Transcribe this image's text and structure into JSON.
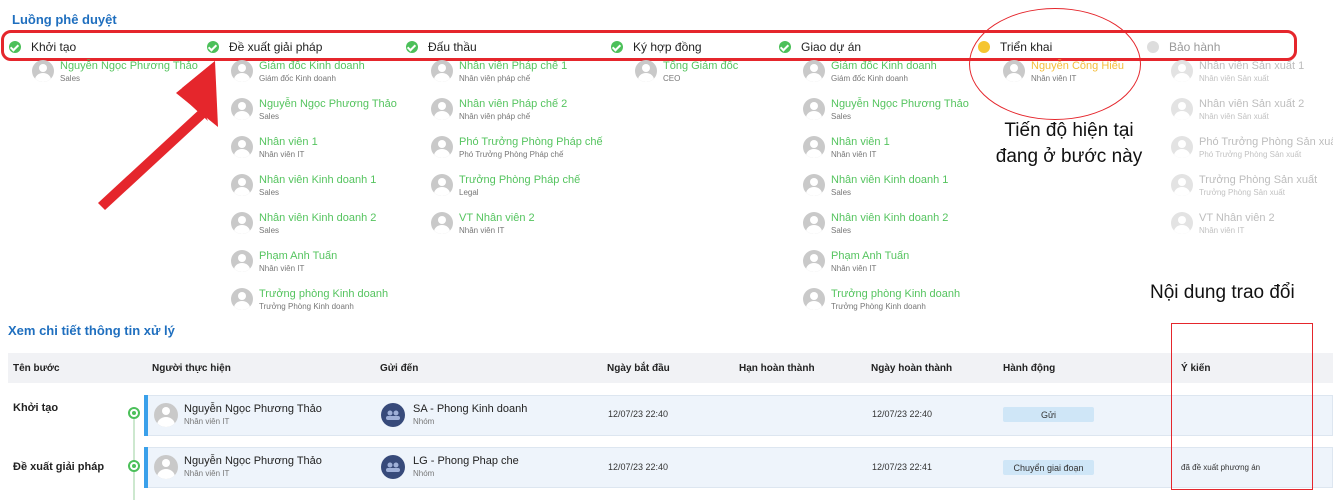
{
  "section_flow_title": "Luồng phê duyệt",
  "section_detail_title": "Xem chi tiết thông tin xử lý",
  "steps": [
    {
      "label": "Khởi tạo",
      "status": "done"
    },
    {
      "label": "Đề xuất giải pháp",
      "status": "done"
    },
    {
      "label": "Đấu thầu",
      "status": "done"
    },
    {
      "label": "Ký hợp đồng",
      "status": "done"
    },
    {
      "label": "Giao dự án",
      "status": "done"
    },
    {
      "label": "Triển khai",
      "status": "current"
    },
    {
      "label": "Bảo hành",
      "status": "pending"
    }
  ],
  "approvers": {
    "khoi_tao": [
      {
        "name": "Nguyễn Ngọc Phương Thảo",
        "role": "Sales"
      }
    ],
    "de_xuat": [
      {
        "name": "Giám đốc Kinh doanh",
        "role": "Giám đốc Kinh doanh"
      },
      {
        "name": "Nguyễn Ngọc Phương Thảo",
        "role": "Sales"
      },
      {
        "name": "Nhân viên 1",
        "role": "Nhân viên IT"
      },
      {
        "name": "Nhân viên Kinh doanh 1",
        "role": "Sales"
      },
      {
        "name": "Nhân viên Kinh doanh 2",
        "role": "Sales"
      },
      {
        "name": "Phạm Anh Tuấn",
        "role": "Nhân viên IT"
      },
      {
        "name": "Trưởng phòng Kinh doanh",
        "role": "Trưởng Phòng Kinh doanh"
      }
    ],
    "dau_thau": [
      {
        "name": "Nhân viên Pháp chế 1",
        "role": "Nhân viên pháp chế"
      },
      {
        "name": "Nhân viên Pháp chế 2",
        "role": "Nhân viên pháp chế"
      },
      {
        "name": "Phó Trưởng Phòng Pháp chế",
        "role": "Phó Trưởng Phòng Pháp chế"
      },
      {
        "name": "Trưởng Phòng Pháp chế",
        "role": "Legal"
      },
      {
        "name": "VT Nhân viên 2",
        "role": "Nhân viên IT"
      }
    ],
    "ky_hop_dong": [
      {
        "name": "Tổng Giám đốc",
        "role": "CEO"
      }
    ],
    "giao_du_an": [
      {
        "name": "Giám đốc Kinh doanh",
        "role": "Giám đốc Kinh doanh"
      },
      {
        "name": "Nguyễn Ngọc Phương Thảo",
        "role": "Sales"
      },
      {
        "name": "Nhân viên 1",
        "role": "Nhân viên IT"
      },
      {
        "name": "Nhân viên Kinh doanh 1",
        "role": "Sales"
      },
      {
        "name": "Nhân viên Kinh doanh 2",
        "role": "Sales"
      },
      {
        "name": "Phạm Anh Tuấn",
        "role": "Nhân viên IT"
      },
      {
        "name": "Trưởng phòng Kinh doanh",
        "role": "Trưởng Phòng Kinh doanh"
      }
    ],
    "trien_khai": [
      {
        "name": "Nguyễn Công Hiếu",
        "role": "Nhân viên IT"
      }
    ],
    "bao_hanh": [
      {
        "name": "Nhân viên Sản xuất 1",
        "role": "Nhân viên Sản xuất"
      },
      {
        "name": "Nhân viên Sản xuất 2",
        "role": "Nhân viên Sản xuất"
      },
      {
        "name": "Phó Trưởng Phòng Sản xuất",
        "role": "Phó Trưởng Phòng Sản xuất"
      },
      {
        "name": "Trưởng Phòng Sản xuất",
        "role": "Trưởng Phòng Sản xuất"
      },
      {
        "name": "VT Nhân viên 2",
        "role": "Nhân viên IT"
      }
    ]
  },
  "annotations": {
    "current_progress": "Tiến độ hiện tại đang ở bước này",
    "exchange_content": "Nội dung trao đổi"
  },
  "table": {
    "headers": [
      "Tên bước",
      "Người thực hiện",
      "Gửi đến",
      "Ngày bắt đầu",
      "Hạn hoàn thành",
      "Ngày hoàn thành",
      "Hành động",
      "Ý kiến"
    ],
    "rows": [
      {
        "step": "Khởi tạo",
        "performer": "Nguyễn Ngọc Phương Thảo",
        "performer_role": "Nhân viên IT",
        "sent_to": "SA - Phong Kinh doanh",
        "sent_to_type": "Nhóm",
        "start": "12/07/23 22:40",
        "deadline": "",
        "completed": "12/07/23 22:40",
        "action": "Gửi",
        "opinion": ""
      },
      {
        "step": "Đề xuất giải pháp",
        "performer": "Nguyễn Ngọc Phương Thảo",
        "performer_role": "Nhân viên IT",
        "sent_to": "LG - Phong Phap che",
        "sent_to_type": "Nhóm",
        "start": "12/07/23 22:40",
        "deadline": "",
        "completed": "12/07/23 22:41",
        "action": "Chuyển giai đoạn",
        "opinion": "đã đề xuất phương án"
      }
    ]
  },
  "colors": {
    "accent_red": "#e5262c",
    "done_green": "#4cc05a",
    "current_yellow": "#f5c530",
    "title_blue": "#1f6fbf"
  }
}
